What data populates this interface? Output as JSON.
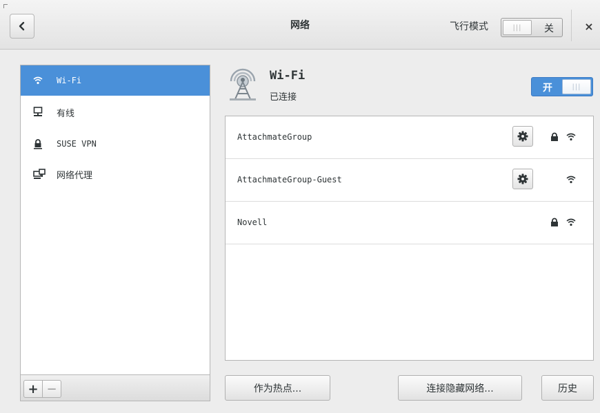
{
  "header": {
    "title": "网络",
    "back_icon": "chevron-left-icon",
    "airplane_mode_label": "飞行模式",
    "airplane_mode_state": "关",
    "close_label": "×"
  },
  "sidebar": {
    "items": [
      {
        "label": "Wi-Fi",
        "icon": "wifi-icon",
        "active": true
      },
      {
        "label": "有线",
        "icon": "wired-network-icon",
        "active": false
      },
      {
        "label": "SUSE VPN",
        "icon": "vpn-lock-icon",
        "active": false
      },
      {
        "label": "网络代理",
        "icon": "network-proxy-icon",
        "active": false
      }
    ],
    "add_label": "+",
    "remove_label": "−"
  },
  "device": {
    "name": "Wi-Fi",
    "status": "已连接",
    "switch_state": "开"
  },
  "networks": [
    {
      "ssid": "AttachmateGroup",
      "has_settings": true,
      "secured": true
    },
    {
      "ssid": "AttachmateGroup-Guest",
      "has_settings": true,
      "secured": false
    },
    {
      "ssid": "Novell",
      "has_settings": false,
      "secured": true
    }
  ],
  "actions": {
    "hotspot": "作为热点...",
    "connect_hidden": "连接隐藏网络...",
    "history": "历史"
  },
  "colors": {
    "accent": "#4a90d9",
    "background": "#ededed"
  }
}
